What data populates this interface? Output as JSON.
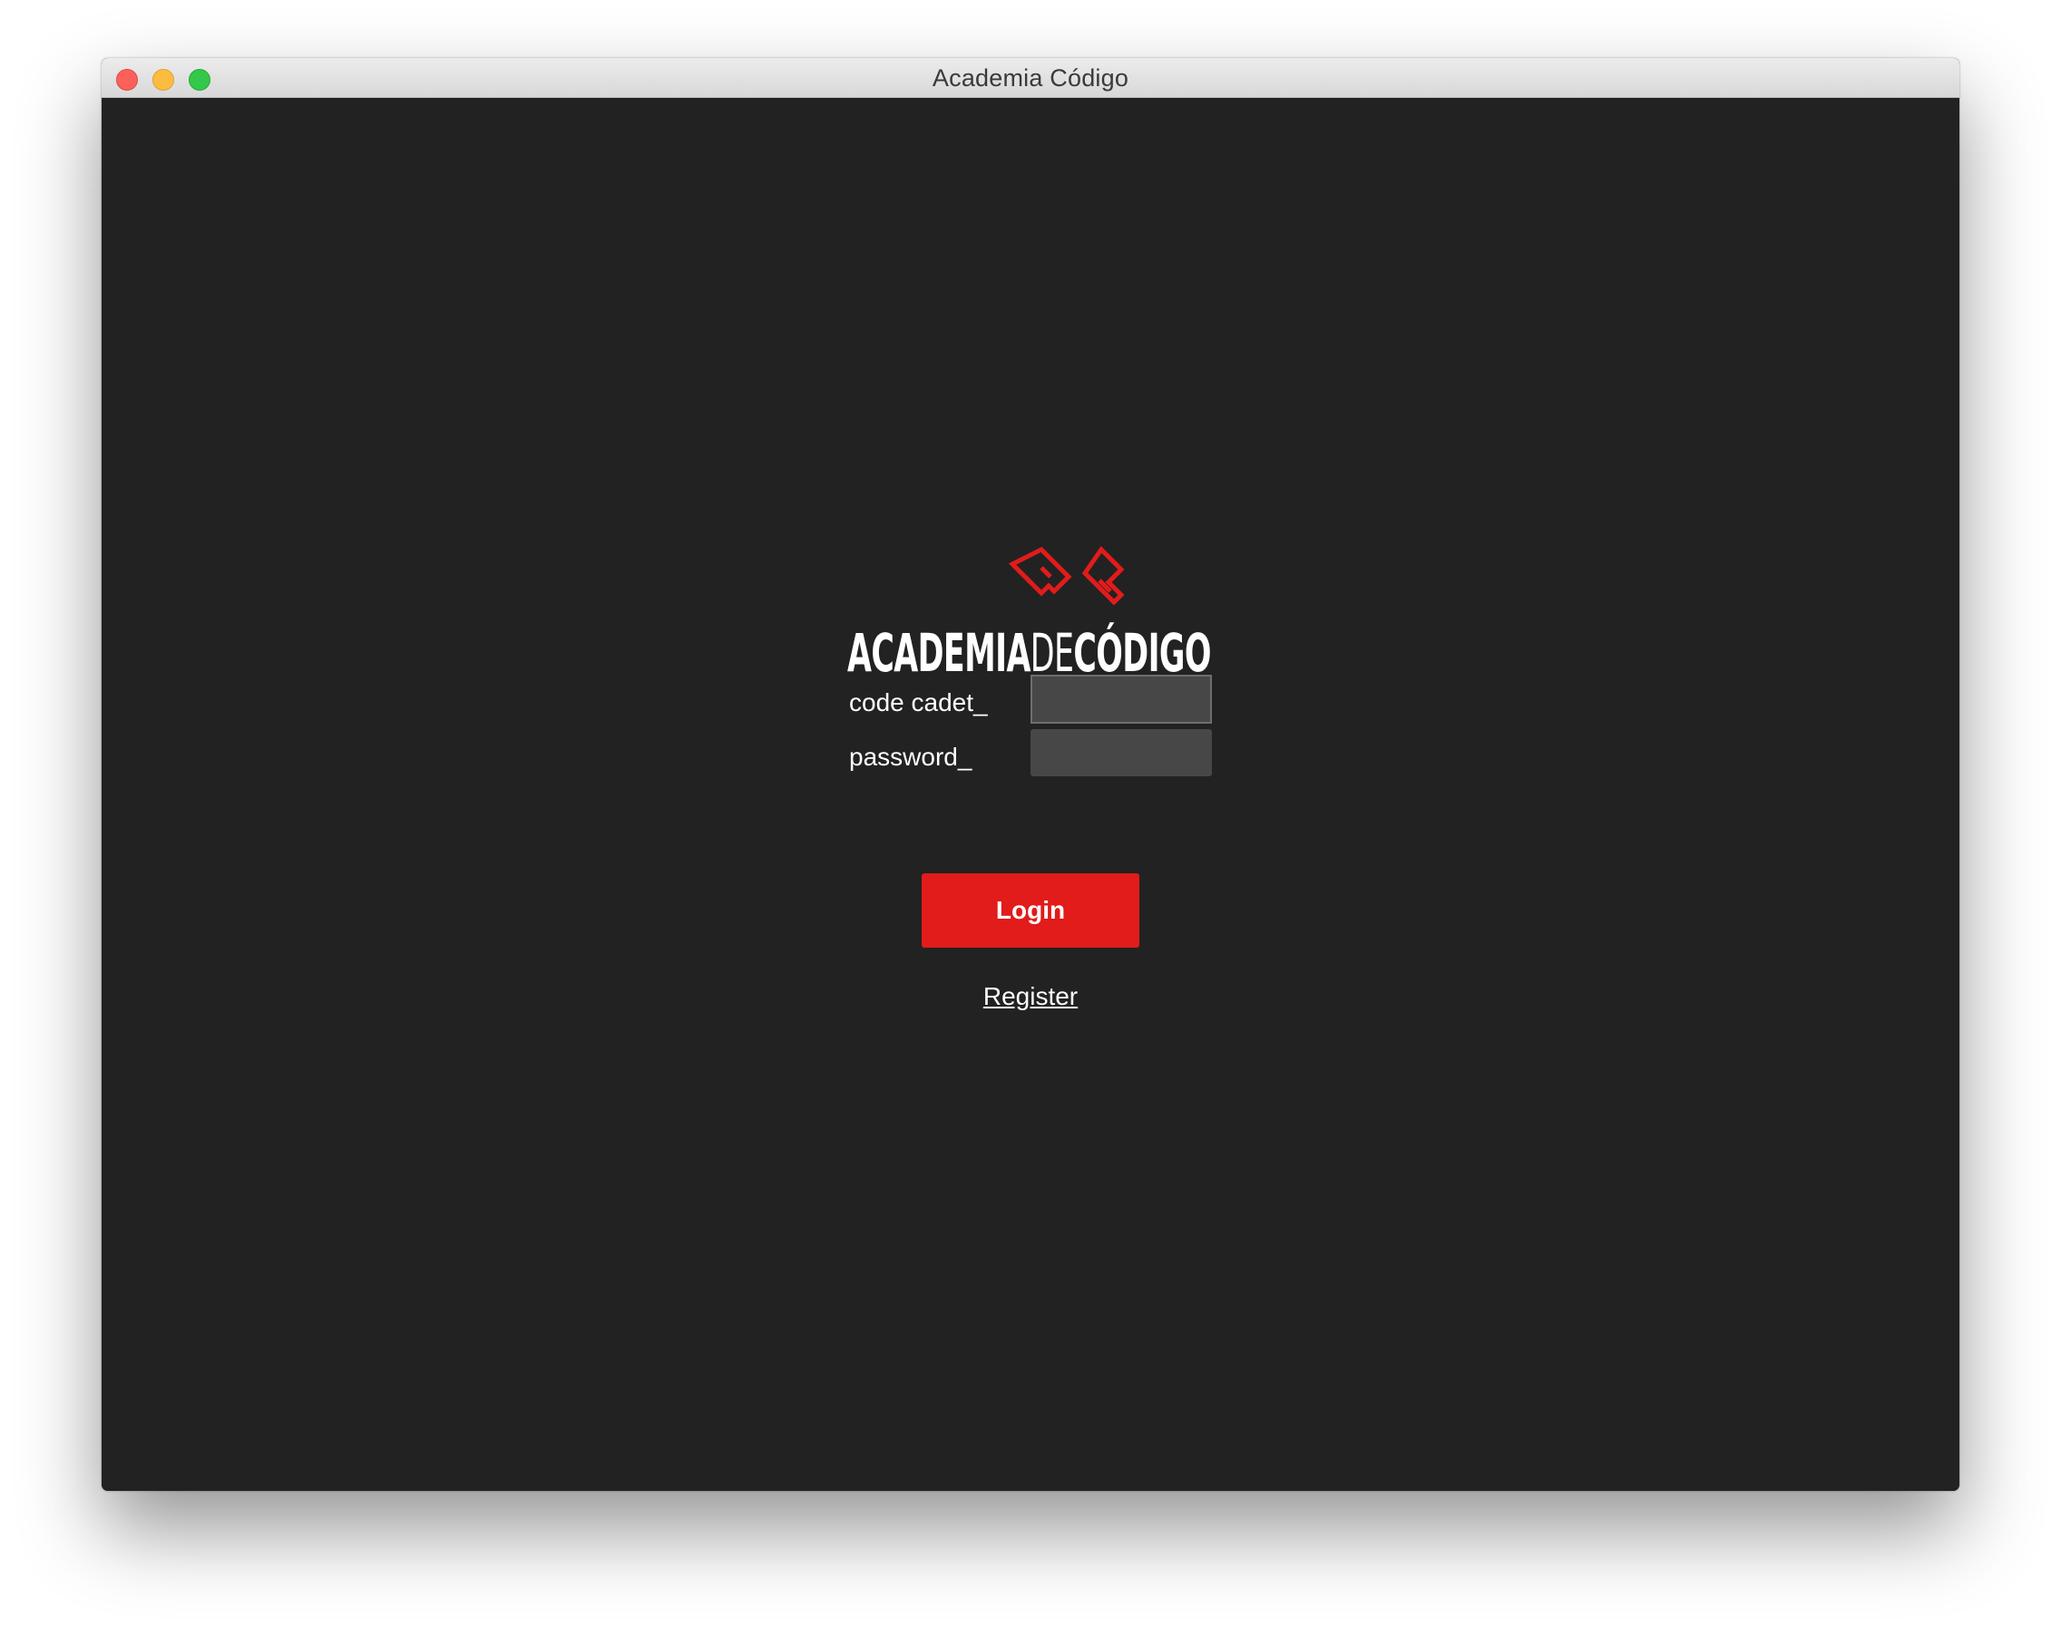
{
  "window": {
    "title": "Academia Código"
  },
  "logo": {
    "wordmark_bold_1": "ACADEMIA",
    "wordmark_light": "DE",
    "wordmark_bold_2": "CÓDIGO",
    "accent_color": "#e21b1b"
  },
  "form": {
    "code_cadet_label": "code cadet_",
    "code_cadet_value": "",
    "password_label": "password_",
    "password_value": "",
    "login_label": "Login",
    "register_label": "Register"
  },
  "colors": {
    "background": "#222222",
    "field_background": "#474747",
    "button": "#e21b1b",
    "text": "#ffffff"
  }
}
